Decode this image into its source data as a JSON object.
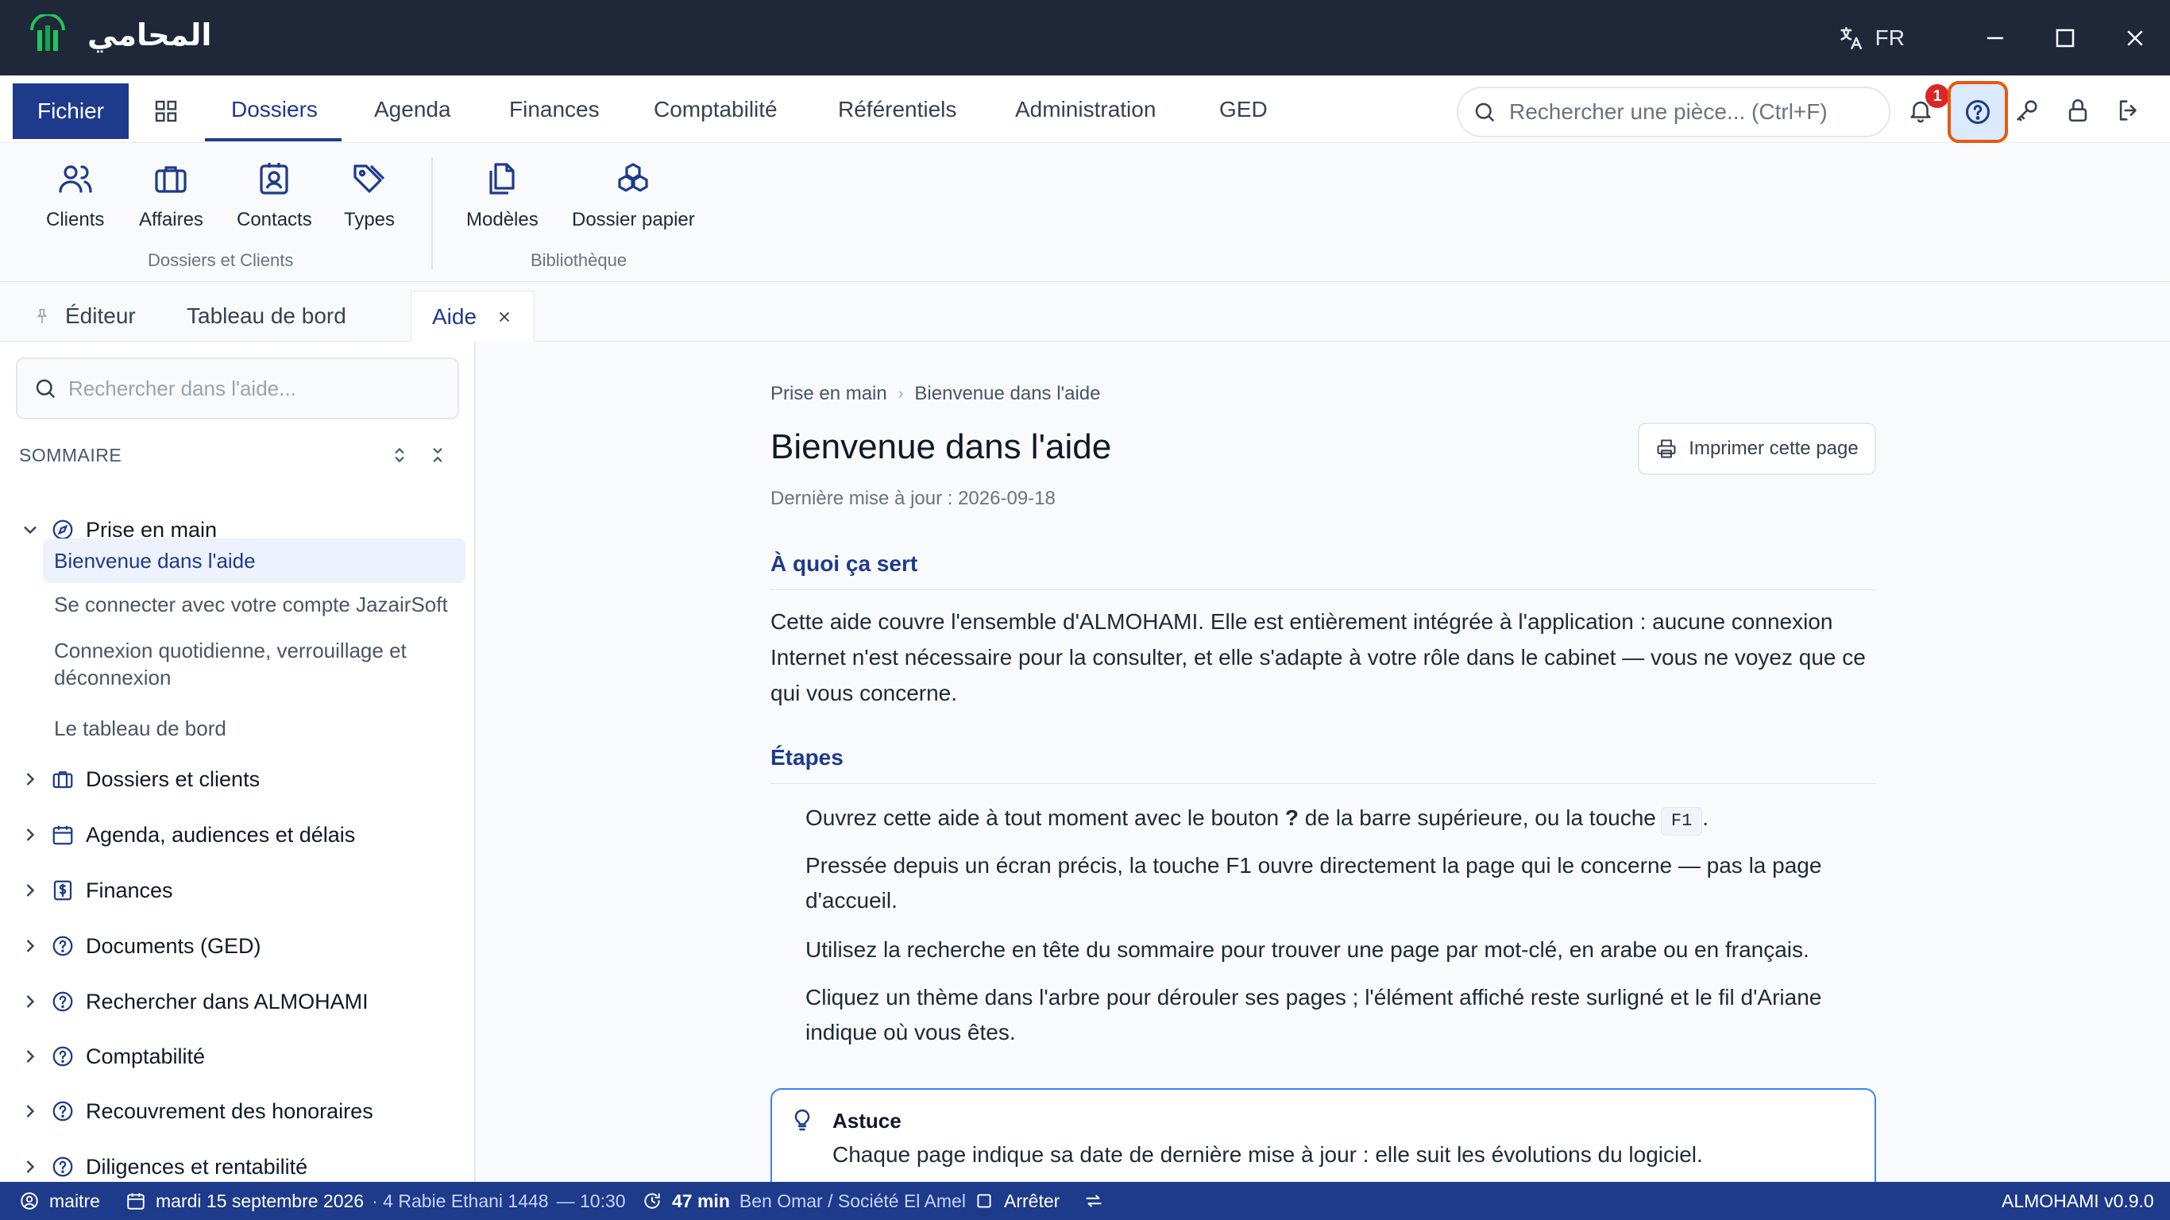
{
  "app": {
    "logo_text": "المحامي",
    "language": "FR",
    "colors": {
      "titlebar": "#1e2838",
      "accent": "#1e3a8a",
      "highlight": "#ea580c",
      "badge": "#dc2626"
    }
  },
  "menubar": {
    "fichier": "Fichier",
    "items": [
      "Dossiers",
      "Agenda",
      "Finances",
      "Comptabilité",
      "Référentiels",
      "Administration",
      "GED"
    ],
    "active": "Dossiers",
    "search_placeholder": "Rechercher une pièce... (Ctrl+F)",
    "notification_count": "1",
    "icons": [
      "apps-grid-icon",
      "bell-icon",
      "help-icon",
      "key-icon",
      "lock-icon",
      "logout-icon"
    ]
  },
  "ribbon": {
    "groups": [
      {
        "label": "Dossiers et Clients",
        "items": [
          "Clients",
          "Affaires",
          "Contacts",
          "Types"
        ]
      },
      {
        "label": "Bibliothèque",
        "items": [
          "Modèles",
          "Dossier papier"
        ]
      }
    ]
  },
  "tabs": [
    {
      "label": "Éditeur",
      "pinned": true
    },
    {
      "label": "Tableau de bord"
    },
    {
      "label": "Aide",
      "active": true,
      "closable": true
    }
  ],
  "sidebar": {
    "search_placeholder": "Rechercher dans l'aide...",
    "sommaire": "SOMMAIRE",
    "tree": [
      {
        "label": "Prise en main",
        "icon": "compass-icon",
        "expanded": true,
        "children": [
          "Bienvenue dans l'aide",
          "Se connecter avec votre compte JazairSoft",
          "Connexion quotidienne, verrouillage et déconnexion",
          "Le tableau de bord"
        ]
      },
      {
        "label": "Dossiers et clients",
        "icon": "briefcase-icon"
      },
      {
        "label": "Agenda, audiences et délais",
        "icon": "calendar-icon"
      },
      {
        "label": "Finances",
        "icon": "dollar-icon"
      },
      {
        "label": "Documents (GED)",
        "icon": "help-circle-icon"
      },
      {
        "label": "Rechercher dans ALMOHAMI",
        "icon": "help-circle-icon"
      },
      {
        "label": "Comptabilité",
        "icon": "help-circle-icon"
      },
      {
        "label": "Recouvrement des honoraires",
        "icon": "help-circle-icon"
      },
      {
        "label": "Diligences et rentabilité",
        "icon": "help-circle-icon"
      }
    ]
  },
  "content": {
    "breadcrumb": [
      "Prise en main",
      "Bienvenue dans l'aide"
    ],
    "title": "Bienvenue dans l'aide",
    "print_button": "Imprimer cette page",
    "updated": "Dernière mise à jour : 2026-09-18",
    "section1": "À quoi ça sert",
    "paragraph": "Cette aide couvre l'ensemble d'ALMOHAMI. Elle est entièrement intégrée à l'application : aucune connexion Internet n'est nécessaire pour la consulter, et elle s'adapte à votre rôle dans le cabinet — vous ne voyez que ce qui vous concerne.",
    "section2": "Étapes",
    "step1_a": "Ouvrez cette aide à tout moment avec le bouton ",
    "step1_b": "?",
    "step1_c": " de la barre supérieure, ou la touche",
    "step1_key": "F1",
    "step1_end": ".",
    "step2": "Pressée depuis un écran précis, la touche F1 ouvre directement la page qui le concerne — pas la page d'accueil.",
    "step3": "Utilisez la recherche en tête du sommaire pour trouver une page par mot-clé, en arabe ou en français.",
    "step4": "Cliquez un thème dans l'arbre pour dérouler ses pages ; l'élément affiché reste surligné et le fil d'Ariane indique où vous êtes.",
    "tip_title": "Astuce",
    "tip_text": "Chaque page indique sa date de dernière mise à jour : elle suit les évolutions du logiciel."
  },
  "statusbar": {
    "user": "maitre",
    "date": "mardi 15 septembre 2026",
    "hijri": "· 4 Rabie Ethani 1448",
    "time": "— 10:30",
    "timer": "47 min",
    "timer_client": "Ben Omar / Société El Amel",
    "stop": "Arrêter",
    "version": "ALMOHAMI v0.9.0"
  }
}
